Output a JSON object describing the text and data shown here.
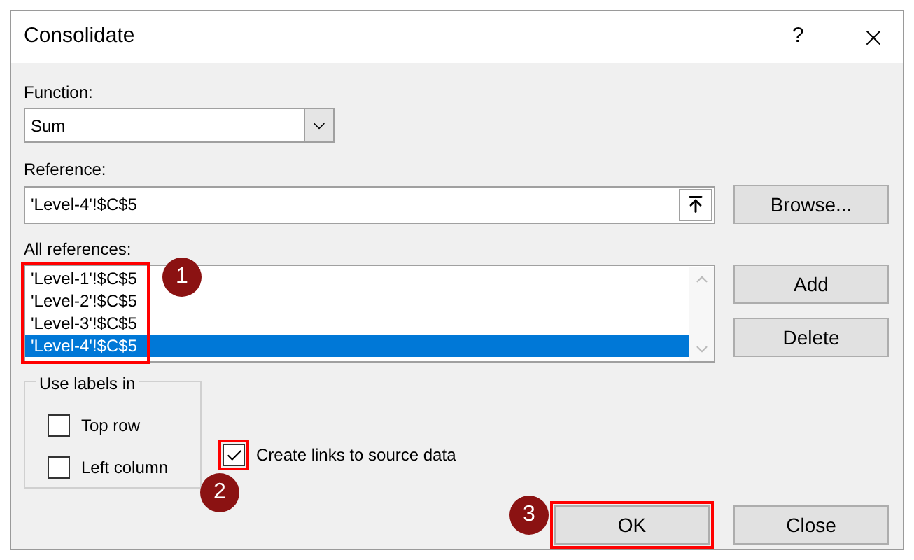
{
  "window": {
    "title": "Consolidate",
    "help": "?"
  },
  "function": {
    "label": "Function:",
    "value": "Sum"
  },
  "reference": {
    "label": "Reference:",
    "value": "'Level-4'!$C$5"
  },
  "browse_button": "Browse...",
  "all_references": {
    "label": "All references:",
    "highlighted": true,
    "items": [
      {
        "text": "'Level-1'!$C$5",
        "selected": false
      },
      {
        "text": "'Level-2'!$C$5",
        "selected": false
      },
      {
        "text": "'Level-3'!$C$5",
        "selected": false
      },
      {
        "text": "'Level-4'!$C$5",
        "selected": true
      }
    ]
  },
  "add_button": "Add",
  "delete_button": "Delete",
  "use_labels_in": {
    "label": "Use labels in",
    "options": [
      {
        "label": "Top row",
        "checked": false
      },
      {
        "label": "Left column",
        "checked": false
      }
    ]
  },
  "create_links": {
    "label": "Create links to source data",
    "checked": true,
    "highlighted": true
  },
  "ok_button": {
    "label": "OK",
    "highlighted": true
  },
  "close_button": "Close",
  "annotations": [
    {
      "kind": "marker",
      "text": "1"
    },
    {
      "kind": "marker",
      "text": "2"
    },
    {
      "kind": "marker",
      "text": "3"
    }
  ]
}
